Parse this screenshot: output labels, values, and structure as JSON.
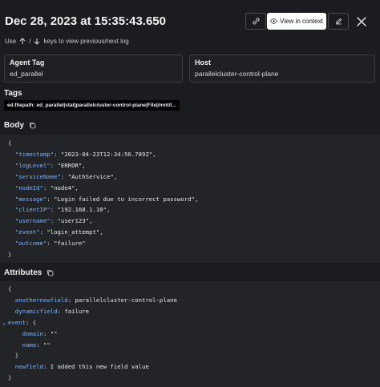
{
  "header": {
    "title": "Dec 28, 2023 at 15:35:43.650",
    "view_in_context_label": "View in context"
  },
  "hint": {
    "prefix": "Use",
    "separator": "/",
    "suffix": "keys to view previous/next log"
  },
  "cards": {
    "agent_tag": {
      "label": "Agent Tag",
      "value": "ed_parallel"
    },
    "host": {
      "label": "Host",
      "value": "parallelcluster-control-plane"
    }
  },
  "tags": {
    "title": "Tags",
    "chip": "ed.filepath: ed_parallel|stat|parallelcluster-control-plane|File|/mnt/l..."
  },
  "body": {
    "title": "Body",
    "open_brace": "{",
    "close_brace": "}",
    "fields": [
      {
        "key": "\"timestamp\"",
        "value": "\"2023-04-23T12:34:56.789Z\","
      },
      {
        "key": "\"logLevel\"",
        "value": "\"ERROR\","
      },
      {
        "key": "\"serviceName\"",
        "value": "\"AuthService\","
      },
      {
        "key": "\"nodeId\"",
        "value": "\"node4\","
      },
      {
        "key": "\"message\"",
        "value": "\"Login failed due to incorrect password\","
      },
      {
        "key": "\"clientIP\"",
        "value": "\"192.168.1.10\","
      },
      {
        "key": "\"username\"",
        "value": "\"user123\","
      },
      {
        "key": "\"event\"",
        "value": "\"login_attempt\","
      },
      {
        "key": "\"outcome\"",
        "value": "\"failure\""
      }
    ]
  },
  "attributes": {
    "title": "Attributes",
    "open_brace": "{",
    "close_brace": "}",
    "anothernewfield_key": "anothernewfield",
    "anothernewfield_value": "parallelcluster-control-plane",
    "dynamicfield_key": "dynamicfield",
    "dynamicfield_value": "failure",
    "event_key": "event",
    "event_open": "{",
    "domain_key": "domain",
    "domain_value": "\"\"",
    "name_key": "name",
    "name_value": "\"\"",
    "event_close": "}",
    "newfield_key": "newfield",
    "newfield_value": "I added this new field value"
  },
  "colors": {
    "background": "#1b1c1f",
    "code_background": "#232427",
    "key_blue": "#7ab3ff"
  }
}
